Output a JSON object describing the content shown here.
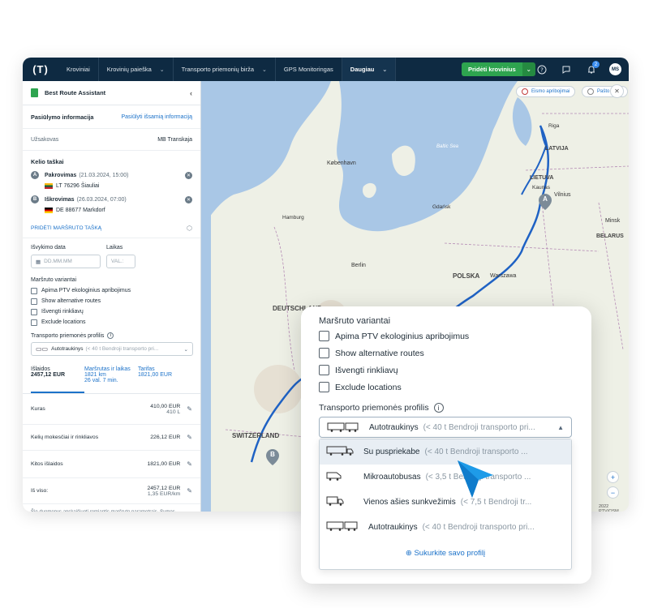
{
  "nav": {
    "logo": "(T)",
    "items": [
      {
        "label": "Kroviniai",
        "has_menu": false
      },
      {
        "label": "Krovinių paieška",
        "has_menu": true
      },
      {
        "label": "Transporto priemonių birža",
        "has_menu": true
      },
      {
        "label": "GPS Monitoringas",
        "has_menu": false
      },
      {
        "label": "Daugiau",
        "has_menu": true,
        "active": true
      }
    ],
    "add_cargo": "Pridėti krovinius",
    "notifications_count": "2",
    "avatar_initials": "MS"
  },
  "sidebar": {
    "title": "Best Route Assistant",
    "offer_info": "Pasiūlymo informacija",
    "offer_link": "Pasiūlyti išsamią informaciją",
    "customer_label": "Užsakovas",
    "customer_value": "MB Transkaja",
    "waypoints_title": "Kelio taškai",
    "waypoints": [
      {
        "letter": "A",
        "type": "Pakrovimas",
        "date": "(21.03.2024, 15:00)",
        "country": "LT",
        "address": "LT 76296 Šiauliai"
      },
      {
        "letter": "B",
        "type": "Iškrovimas",
        "date": "(26.03.2024, 07:00)",
        "country": "DE",
        "address": "DE 88677 Markdorf"
      }
    ],
    "add_point": "PRIDĖTI MARŠRUTO TAŠKĄ",
    "departure_date_label": "Išvykimo data",
    "departure_date_placeholder": "DD.MM.MM",
    "time_label": "Laikas",
    "time_placeholder": "VAL.:",
    "route_variants_label": "Maršruto variantai",
    "options": [
      "Apima PTV ekologinius apribojimus",
      "Show alternative routes",
      "Išvengti rinkliavų",
      "Exclude locations"
    ],
    "vehicle_profile_label": "Transporto priemonės profilis",
    "vehicle_profile_value": "Autotraukinys",
    "vehicle_profile_desc": "(< 40 t Bendroji transporto pri...",
    "tabs": {
      "costs_label": "Išlaidos",
      "costs_value": "2457,12 EUR",
      "route_label": "Maršrutas ir laikas",
      "route_km": "1821 km",
      "route_time": "26 val. 7 min.",
      "tariff_label": "Tarifas",
      "tariff_value": "1821,00 EUR"
    },
    "costs": [
      {
        "label": "Kuras",
        "value": "410,00 EUR",
        "sub": "410 L"
      },
      {
        "label": "Kelių mokesčiai ir rinkliavos",
        "value": "226,12 EUR",
        "sub": ""
      },
      {
        "label": "Kitos išlaidos",
        "value": "1821,00 EUR",
        "sub": ""
      },
      {
        "label": "Iš viso:",
        "value": "2457,12 EUR",
        "sub": "1,35 EUR/km"
      }
    ],
    "footnote": "Šie duomenys apskaičiuoti remiantis maršruto parametrais. Sumos pateikiamos be PVM. Visos skaičiavimo galima keisti."
  },
  "map": {
    "traffic_btn": "Eismo apribojimai",
    "postal_btn": "Pašto kodai",
    "labels": [
      "LATVIJA",
      "LIETUVA",
      "Vilnius",
      "Minsk",
      "BELARUS",
      "København",
      "POLSKA",
      "Warszawa",
      "Berlin",
      "DEUTSCHLAND",
      "SWITZERLAND",
      "Baltic Sea",
      "Hamburg",
      "Gdańsk",
      "Kaunas",
      "Riga"
    ],
    "marker_a": "A",
    "marker_b": "B",
    "copyright": "2022 PTV/OSM"
  },
  "popup": {
    "route_variants_label": "Maršruto variantai",
    "options": [
      "Apima PTV ekologinius apribojimus",
      "Show alternative routes",
      "Išvengti rinkliavų",
      "Exclude locations"
    ],
    "vehicle_profile_label": "Transporto priemonės profilis",
    "selected_name": "Autotraukinys",
    "selected_desc": "(< 40 t Bendroji transporto pri...",
    "dropdown_items": [
      {
        "name": "Su puspriekabe",
        "desc": "(< 40 t Bendroji transporto ...",
        "icon": "semi-trailer-icon"
      },
      {
        "name": "Mikroautobusas",
        "desc": "(< 3,5 t Bendroji transporto ...",
        "icon": "van-icon"
      },
      {
        "name": "Vienos ašies sunkvežimis",
        "desc": "(< 7,5 t Bendroji tr...",
        "icon": "single-axle-truck-icon"
      },
      {
        "name": "Autotraukinys",
        "desc": "(< 40 t Bendroji transporto pri...",
        "icon": "road-train-icon"
      }
    ],
    "create_profile": "Sukurkite savo profilį"
  }
}
